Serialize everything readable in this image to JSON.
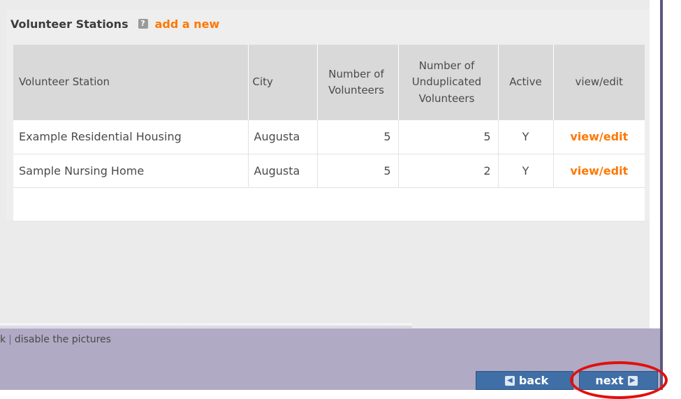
{
  "stations_box": {
    "title": "Volunteer Stations",
    "help_icon": "help-icon",
    "add_link": "add a new"
  },
  "table": {
    "headers": {
      "station": "Volunteer Station",
      "city": "City",
      "num_volunteers": "Number of Volunteers",
      "num_unduplicated": "Number of Unduplicated Volunteers",
      "active": "Active",
      "view_edit": "view/edit"
    },
    "rows": [
      {
        "station": "Example Residential Housing",
        "city": "Augusta",
        "num_volunteers": "5",
        "num_unduplicated": "5",
        "active": "Y",
        "action": "view/edit"
      },
      {
        "station": "Sample Nursing Home",
        "city": "Augusta",
        "num_volunteers": "5",
        "num_unduplicated": "2",
        "active": "Y",
        "action": "view/edit"
      }
    ]
  },
  "footer": {
    "partial_link": "k",
    "separator": "|",
    "disable_pictures": "disable the pictures"
  },
  "nav": {
    "back_label": "back",
    "next_label": "next",
    "back_icon": "arrow-left-icon",
    "next_icon": "arrow-right-icon"
  },
  "colors": {
    "accent_link": "#ff7700",
    "footer_bg": "#b0aac4",
    "button_bg": "#3f6fa6",
    "highlight_ring": "#e01010"
  }
}
